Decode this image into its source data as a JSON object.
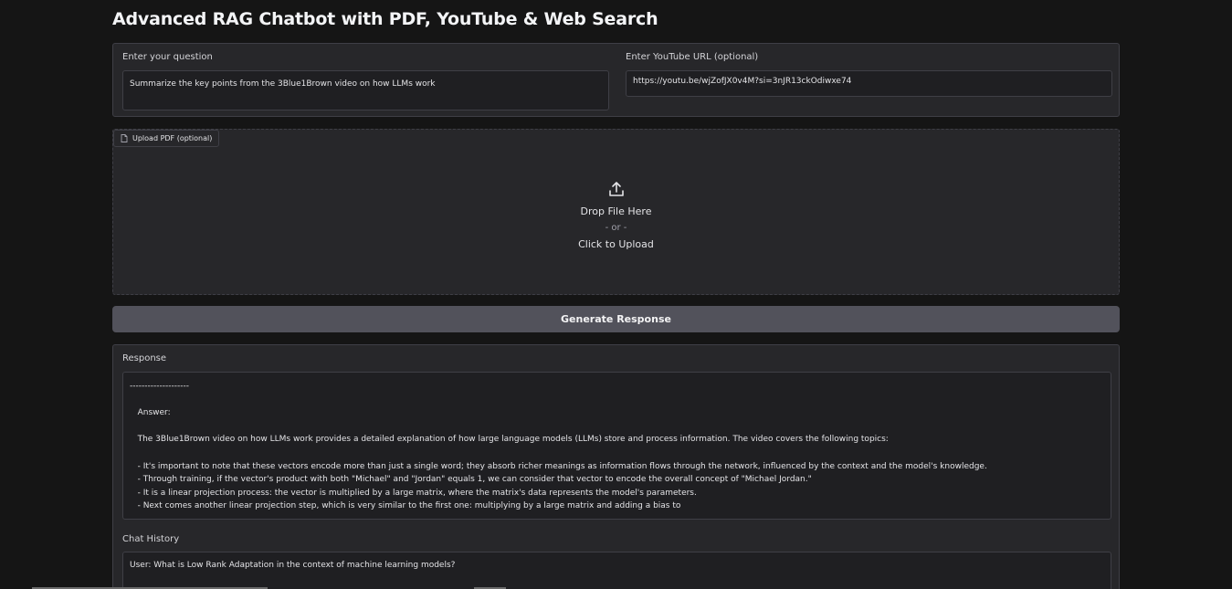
{
  "page": {
    "title": "Advanced RAG Chatbot with PDF, YouTube & Web Search"
  },
  "question": {
    "label": "Enter your question",
    "value": "Summarize the key points from the 3Blue1Brown video on how LLMs work"
  },
  "youtube": {
    "label": "Enter YouTube URL (optional)",
    "value": "https://youtu.be/wjZofJX0v4M?si=3nJR13ckOdiwxe74"
  },
  "upload": {
    "tag_label": "Upload PDF (optional)",
    "tag_icon": "file-icon",
    "upload_icon": "upload-icon",
    "drop_text": "Drop File Here",
    "or_text": "- or -",
    "click_text": "Click to Upload"
  },
  "generate_button": {
    "label": "Generate Response"
  },
  "response": {
    "label": "Response",
    "lines": [
      "--------------------",
      "",
      "   Answer:",
      "",
      "   The 3Blue1Brown video on how LLMs work provides a detailed explanation of how large language models (LLMs) store and process information. The video covers the following topics:",
      "",
      "   - It's important to note that these vectors encode more than just a single word; they absorb richer meanings as information flows through the network, influenced by the context and the model's knowledge.",
      "   - Through training, if the vector's product with both \"Michael\" and \"Jordan\" equals 1, we can consider that vector to encode the overall concept of \"Michael Jordan.\"",
      "   - It is a linear projection process: the vector is multiplied by a large matrix, where the matrix's data represents the model's parameters.",
      "   - Next comes another linear projection step, which is very similar to the first one: multiplying by a large matrix and adding a bias to"
    ]
  },
  "chat_history": {
    "label": "Chat History",
    "first_line": "User: What is Low Rank Adaptation in the context of machine learning models?"
  }
}
